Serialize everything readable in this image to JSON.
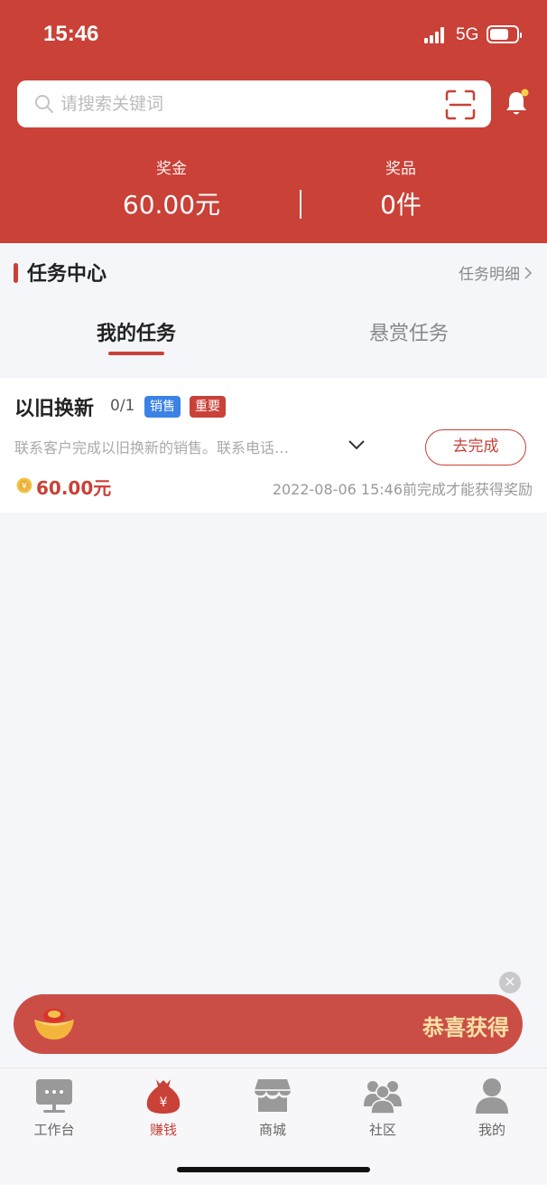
{
  "status_bar": {
    "time": "15:46",
    "network": "5G",
    "battery_level": 0.7
  },
  "search": {
    "placeholder": "请搜索关键词"
  },
  "stats": {
    "bonus_label": "奖金",
    "bonus_value": "60.00元",
    "prize_label": "奖品",
    "prize_value": "0件"
  },
  "task_center": {
    "title": "任务中心",
    "detail_link": "任务明细",
    "tabs": [
      {
        "label": "我的任务",
        "active": true
      },
      {
        "label": "悬赏任务",
        "active": false
      }
    ]
  },
  "task": {
    "title": "以旧换新",
    "progress": "0/1",
    "tags": [
      "销售",
      "重要"
    ],
    "description": "联系客户完成以旧换新的销售。联系电话…",
    "action_label": "去完成",
    "reward": "60.00元",
    "deadline": "2022-08-06 15:46前完成才能获得奖励"
  },
  "banner": {
    "text": "恭喜获得"
  },
  "bottom_nav": {
    "items": [
      {
        "label": "工作台",
        "icon": "workbench-icon",
        "active": false
      },
      {
        "label": "赚钱",
        "icon": "money-bag-icon",
        "active": true
      },
      {
        "label": "商城",
        "icon": "store-icon",
        "active": false
      },
      {
        "label": "社区",
        "icon": "community-icon",
        "active": false
      },
      {
        "label": "我的",
        "icon": "profile-icon",
        "active": false
      }
    ]
  },
  "colors": {
    "brand_red": "#c94137",
    "tag_blue": "#3b82e6",
    "banner_gold": "#f6e1a6",
    "notification_dot": "#f6d24a"
  }
}
